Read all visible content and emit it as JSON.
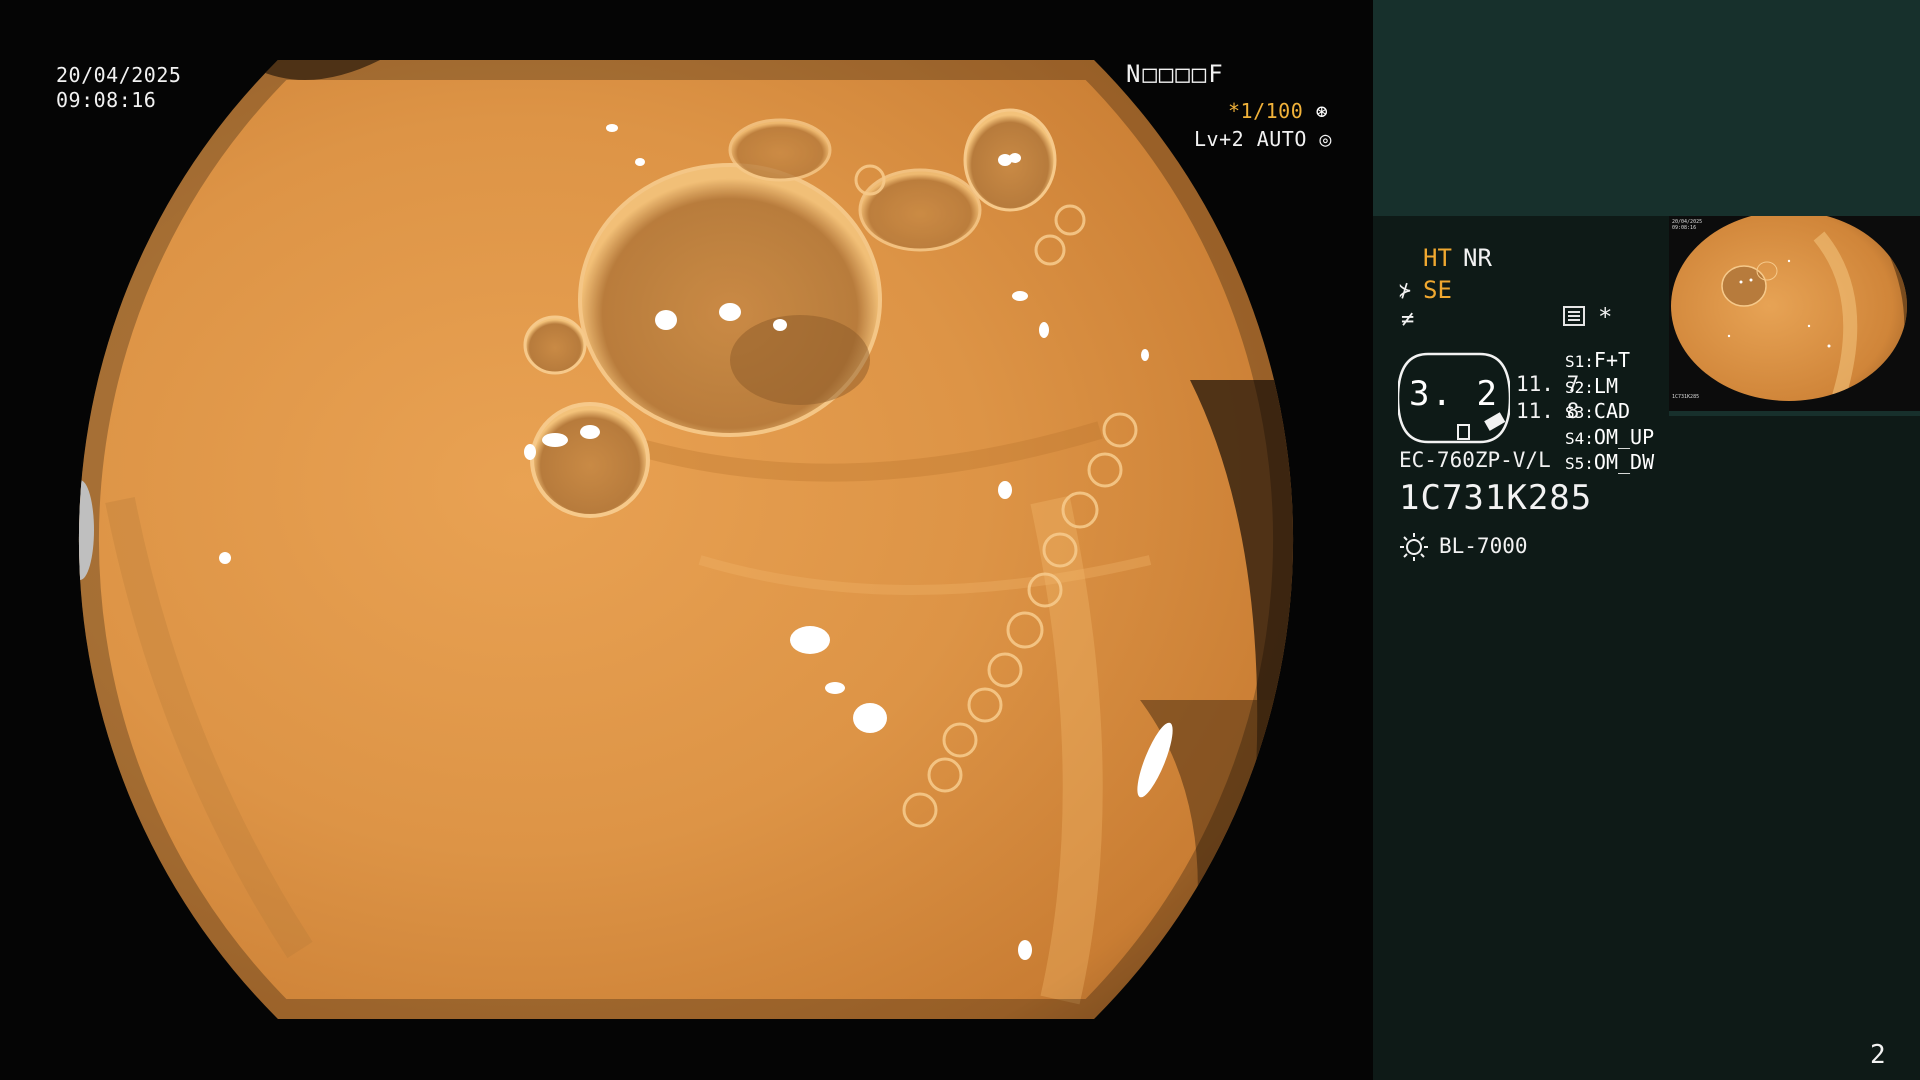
{
  "osd": {
    "date": "20/04/2025",
    "time": "09:08:16",
    "patient_id": "N□□□□F",
    "shutter": "*1/100",
    "iris": "Lv+2 AUTO"
  },
  "panel": {
    "ht": "HT",
    "nr": "NR",
    "se": "SE",
    "star": "*",
    "zoom": "3. 2",
    "value_1": "11. 7",
    "value_2": "11. 8",
    "switches": [
      {
        "key": "S1:",
        "value": "F+T"
      },
      {
        "key": "S2:",
        "value": "LM"
      },
      {
        "key": "S3:",
        "value": "CAD"
      },
      {
        "key": "S4:",
        "value": "OM_UP"
      },
      {
        "key": "S5:",
        "value": "OM_DW"
      }
    ],
    "scope_model": "EC-760ZP-V/L",
    "scope_serial": "1C731K285",
    "light_source": "BL-7000"
  },
  "thumbnail": {
    "date": "20/04/2025",
    "time": "09:08:16",
    "serial": "1C731K285"
  },
  "page_number": "2",
  "colors": {
    "panel_bg": "#0e1a17",
    "panel_top": "#17302c",
    "accent_orange": "#f0a830",
    "mucosa": "#d99446"
  },
  "icons": [
    "structure-enhancement-icon",
    "sharpness-icon",
    "menu-icon",
    "light-source-icon",
    "shutter-wheel-icon",
    "iris-icon"
  ]
}
